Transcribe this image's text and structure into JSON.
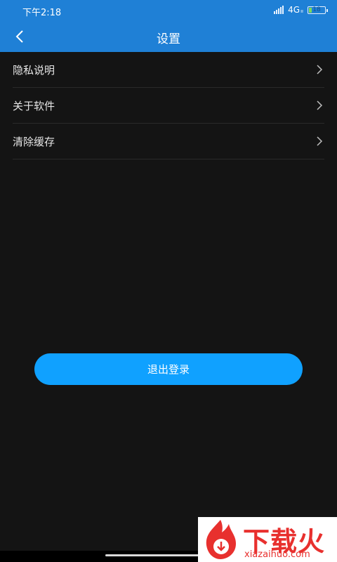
{
  "status_bar": {
    "time": "下午2:18",
    "network": "4G",
    "network_sub": "ıı",
    "battery": "18"
  },
  "header": {
    "title": "设置",
    "back_icon": "chevron-left-icon"
  },
  "settings": [
    {
      "label": "隐私说明",
      "icon": "chevron-right-icon"
    },
    {
      "label": "关于软件",
      "icon": "chevron-right-icon"
    },
    {
      "label": "清除缓存",
      "icon": "chevron-right-icon"
    }
  ],
  "logout_button": "退出登录",
  "watermark": {
    "brand": "下载火",
    "domain": "xiazaihuo.com"
  },
  "colors": {
    "header": "#1f80d6",
    "background": "#141414",
    "button": "#10a1ff"
  }
}
